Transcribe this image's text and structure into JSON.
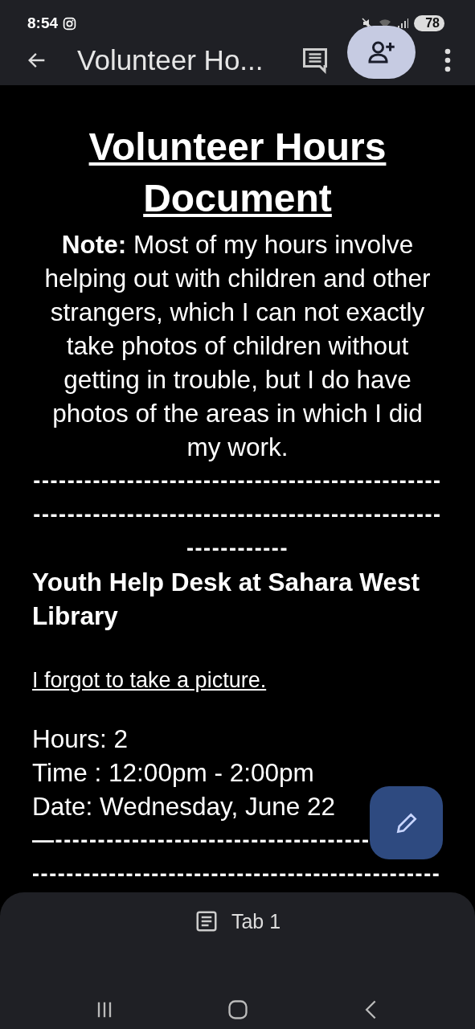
{
  "status_bar": {
    "time": "8:54",
    "battery": "78"
  },
  "toolbar": {
    "title": "Volunteer Ho..."
  },
  "document": {
    "title": "Volunteer Hours Document",
    "note": "**Note:** Most of my hours involve helping out with children and other strangers, which I can not exactly take photos of children without getting in trouble, but I do have photos of the areas in which I did my work.",
    "divider_lines": [
      "------------------------------------------------",
      "------------------------------------------------",
      "------------"
    ],
    "section_heading": "Youth Help Desk at Sahara West Library",
    "link": "I forgot to take a picture.",
    "details": [
      "Hours: 2",
      "Time : 12:00pm - 2:00pm",
      "Date: Wednesday, June 22"
    ],
    "bottom_lines": [
      "—-------------------------------------",
      "------------------------------------------------"
    ]
  },
  "bottom_sheet": {
    "tab_label": "Tab 1"
  }
}
